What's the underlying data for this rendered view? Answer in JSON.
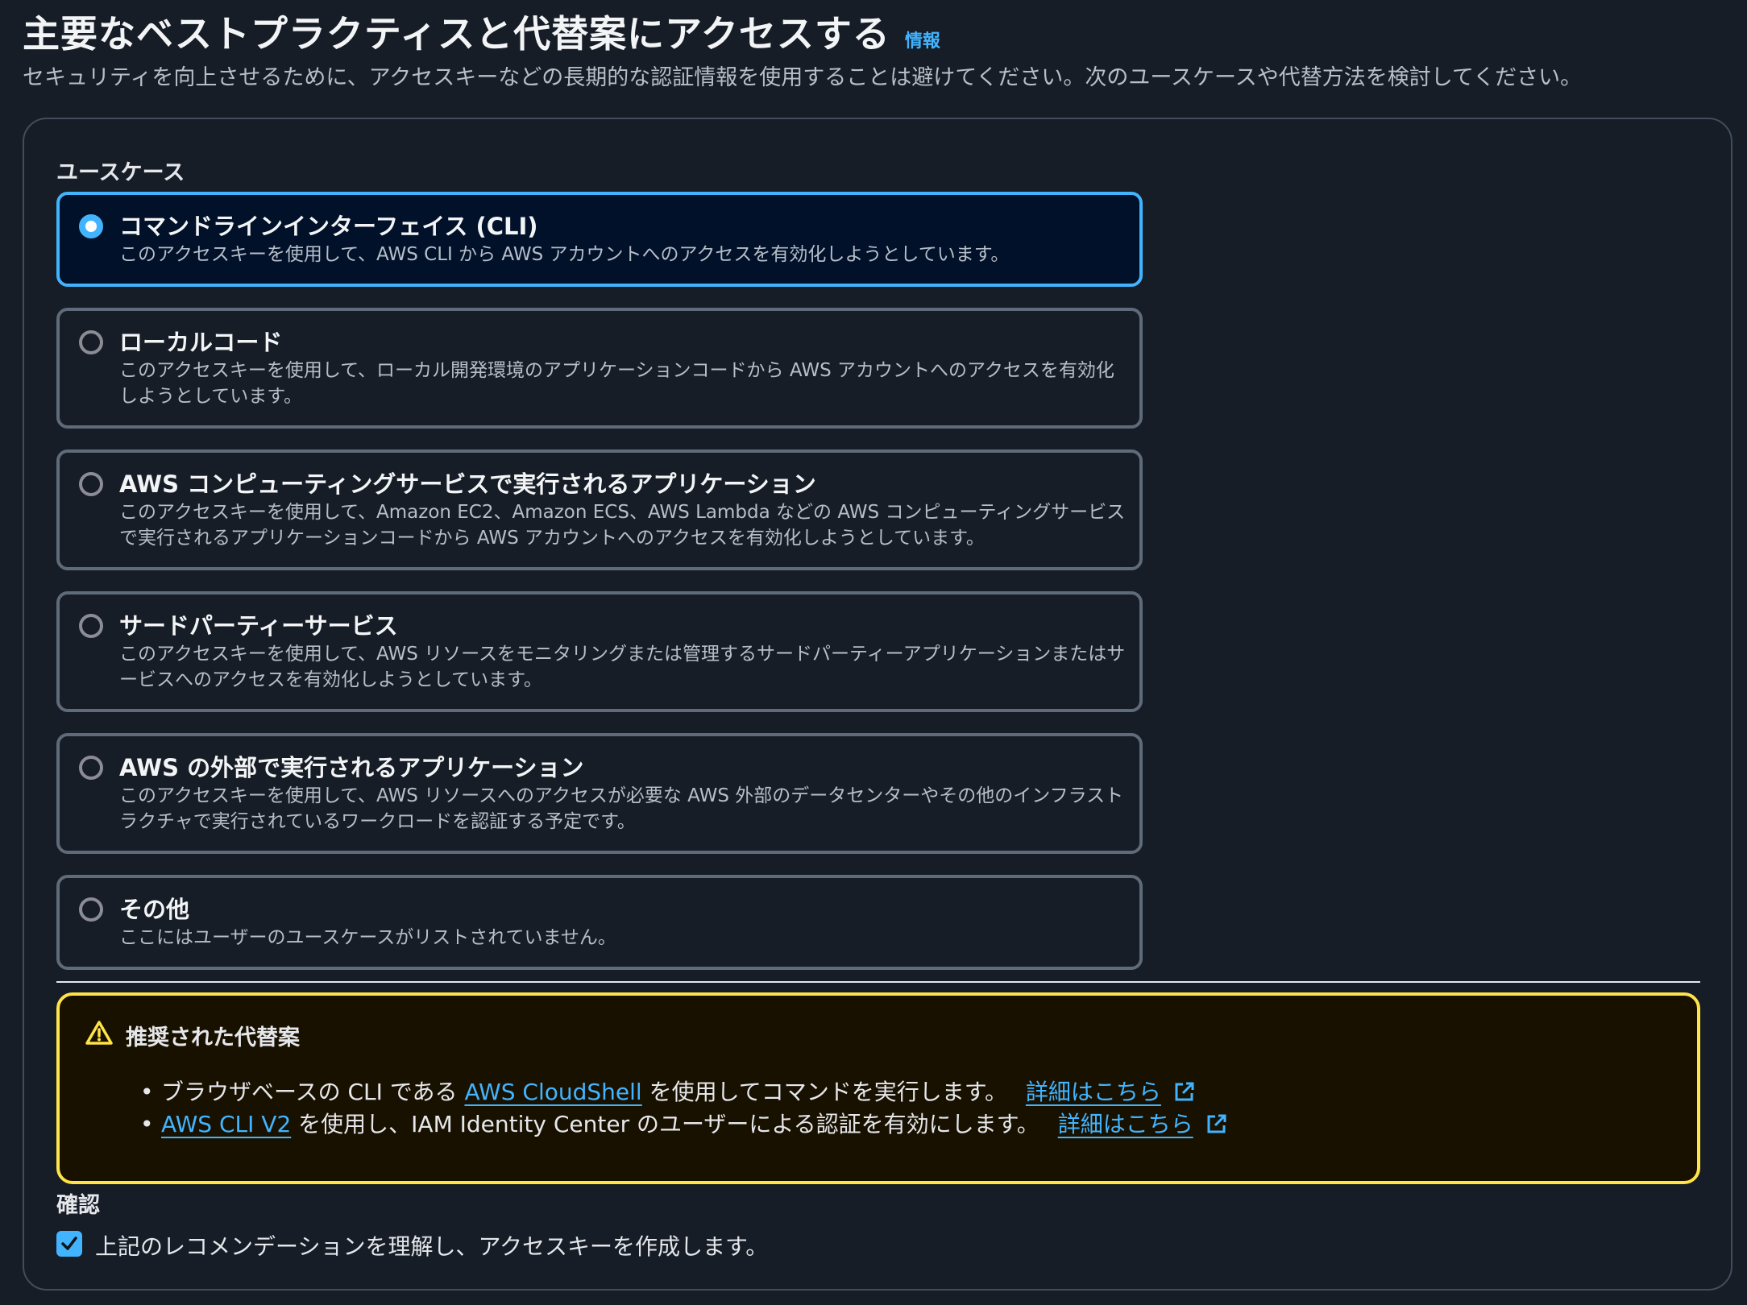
{
  "header": {
    "title": "主要なベストプラクティスと代替案にアクセスする",
    "info_link": "情報",
    "description": "セキュリティを向上させるために、アクセスキーなどの長期的な認証情報を使用することは避けてください。次のユースケースや代替方法を検討してください。"
  },
  "use_cases": {
    "label": "ユースケース",
    "selected": "コマンドラインインターフェイス (CLI)",
    "options": [
      {
        "title": "コマンドラインインターフェイス (CLI)",
        "description": "このアクセスキーを使用して、AWS CLI から AWS アカウントへのアクセスを有効化しようとしています。"
      },
      {
        "title": "ローカルコード",
        "description": "このアクセスキーを使用して、ローカル開発環境のアプリケーションコードから AWS アカウントへのアクセスを有効化しようとしています。"
      },
      {
        "title": "AWS コンピューティングサービスで実行されるアプリケーション",
        "description": "このアクセスキーを使用して、Amazon EC2、Amazon ECS、AWS Lambda などの AWS コンピューティングサービスで実行されるアプリケーションコードから AWS アカウントへのアクセスを有効化しようとしています。"
      },
      {
        "title": "サードパーティーサービス",
        "description": "このアクセスキーを使用して、AWS リソースをモニタリングまたは管理するサードパーティーアプリケーションまたはサービスへのアクセスを有効化しようとしています。"
      },
      {
        "title": "AWS の外部で実行されるアプリケーション",
        "description": "このアクセスキーを使用して、AWS リソースへのアクセスが必要な AWS 外部のデータセンターやその他のインフラストラクチャで実行されているワークロードを認証する予定です。"
      },
      {
        "title": "その他",
        "description": "ここにはユーザーのユースケースがリストされていません。"
      }
    ]
  },
  "alternatives": {
    "title": "推奨された代替案",
    "item1": {
      "prefix": "ブラウザベースの CLI である ",
      "link": "AWS CloudShell",
      "suffix": " を使用してコマンドを実行します。",
      "learn_more": "詳細はこちら"
    },
    "item2": {
      "link": "AWS CLI V2",
      "suffix": " を使用し、IAM Identity Center のユーザーによる認証を有効にします。",
      "learn_more": "詳細はこちら"
    }
  },
  "confirmation": {
    "label": "確認",
    "checkbox_label": "上記のレコメンデーションを理解し、アクセスキーを作成します。",
    "checked": true
  },
  "colors": {
    "background": "#161d26",
    "accent": "#42b4ff",
    "selected_bg": "#001129",
    "warning_border": "#ffe347",
    "warning_bg": "#191100"
  },
  "icons": [
    "warning-icon",
    "external-link-icon",
    "check-icon"
  ]
}
